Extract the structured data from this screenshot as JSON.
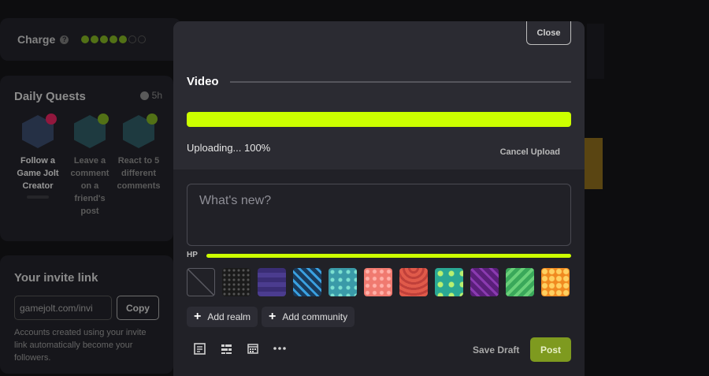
{
  "background": {
    "charge": {
      "label": "Charge",
      "filled": 5,
      "total": 7
    },
    "quests": {
      "title": "Daily Quests",
      "timer": "5h",
      "items": [
        {
          "text": "Follow a Game Jolt Creator",
          "completed": false
        },
        {
          "text": "Leave a comment on a friend's post",
          "completed": true
        },
        {
          "text": "React to 5 different comments",
          "completed": true
        }
      ]
    },
    "invite": {
      "title": "Your invite link",
      "link": "gamejolt.com/invi",
      "copy_label": "Copy",
      "description": "Accounts created using your invite link automatically become your followers."
    }
  },
  "modal": {
    "close_label": "Close",
    "section_title": "Video",
    "upload_progress_percent": 100,
    "upload_status": "Uploading... 100%",
    "cancel_label": "Cancel Upload",
    "post_placeholder": "What's new?",
    "hp_label": "HP",
    "backgrounds": [
      "none",
      "stars",
      "purple-waves",
      "blue-pattern",
      "teal-tiles",
      "pink-dots",
      "red-scales",
      "teal-creature",
      "purple-diamonds",
      "green-leaves",
      "orange-honeycomb"
    ],
    "chips": [
      {
        "label": "Add realm"
      },
      {
        "label": "Add community"
      }
    ],
    "tools": [
      "article-icon",
      "poll-icon",
      "calendar-icon",
      "more-icon"
    ],
    "save_draft_label": "Save Draft",
    "post_label": "Post"
  },
  "colors": {
    "accent": "#ccff00",
    "post_button": "#7e9a1f"
  }
}
